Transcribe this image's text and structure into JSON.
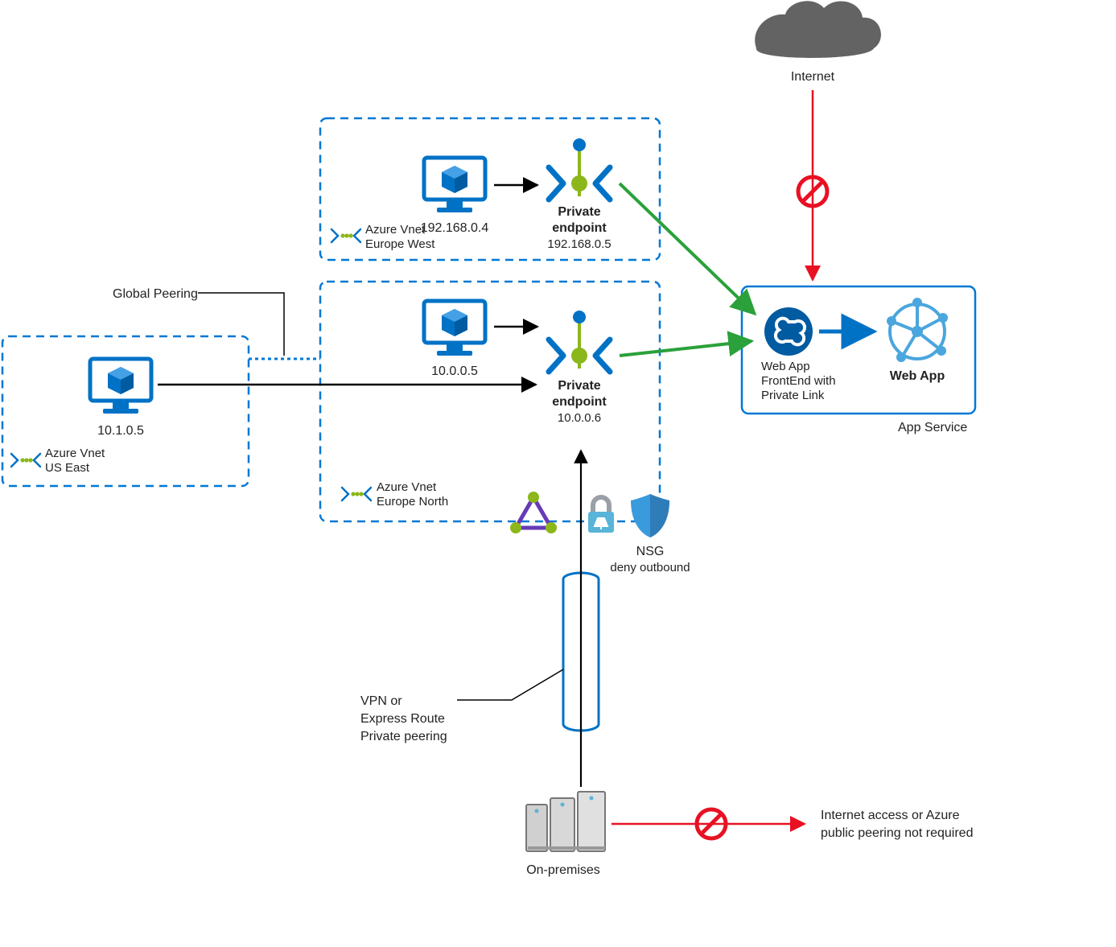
{
  "internet": {
    "label": "Internet"
  },
  "appservice": {
    "outer_label": "App Service",
    "webapp_front": {
      "line1": "Web App",
      "line2": "FrontEnd with",
      "line3": "Private Link"
    },
    "webapp": {
      "label": "Web App"
    }
  },
  "vnet_euwest": {
    "vm_ip": "192.168.0.4",
    "pe_title": "Private",
    "pe_title2": "endpoint",
    "pe_ip": "192.168.0.5",
    "vnet_line1": "Azure Vnet",
    "vnet_line2": "Europe West"
  },
  "vnet_eunorth": {
    "vm_ip": "10.0.0.5",
    "pe_title": "Private",
    "pe_title2": "endpoint",
    "pe_ip": "10.0.0.6",
    "vnet_line1": "Azure Vnet",
    "vnet_line2": "Europe North"
  },
  "vnet_useast": {
    "vm_ip": "10.1.0.5",
    "vnet_line1": "Azure Vnet",
    "vnet_line2": "US East"
  },
  "global_peering": "Global Peering",
  "vpn": {
    "line1": "VPN or",
    "line2": "Express Route",
    "line3": "Private peering"
  },
  "onprem": {
    "label": "On-premises"
  },
  "nsg": {
    "title": "NSG",
    "sub": "deny outbound"
  },
  "internet_note": {
    "line1": "Internet access or Azure",
    "line2": "public peering not required"
  }
}
